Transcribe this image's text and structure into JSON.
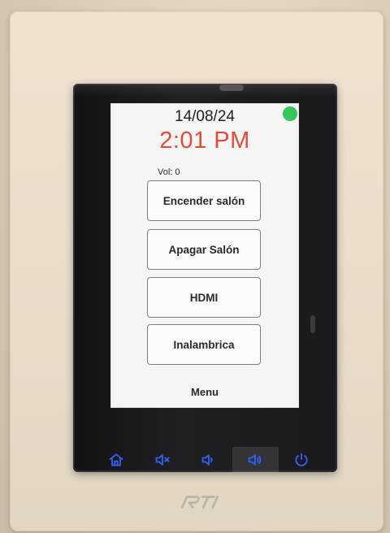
{
  "device": {
    "brand_logo": "RTI"
  },
  "screen": {
    "date": "14/08/24",
    "time": "2:01 PM",
    "volume": "Vol: 0",
    "buttons": [
      {
        "label": "Encender salón"
      },
      {
        "label": "Apagar Salón"
      },
      {
        "label": "HDMI"
      },
      {
        "label": "Inalambrica"
      }
    ],
    "menu_label": "Menu"
  },
  "controls": [
    {
      "icon": "home-icon"
    },
    {
      "icon": "volume-mute-icon"
    },
    {
      "icon": "volume-down-icon"
    },
    {
      "icon": "volume-up-icon"
    },
    {
      "icon": "power-icon"
    }
  ],
  "colors": {
    "time": "#e04c3a",
    "status_dot": "#34c759",
    "control_icons": "#2d63ff"
  }
}
